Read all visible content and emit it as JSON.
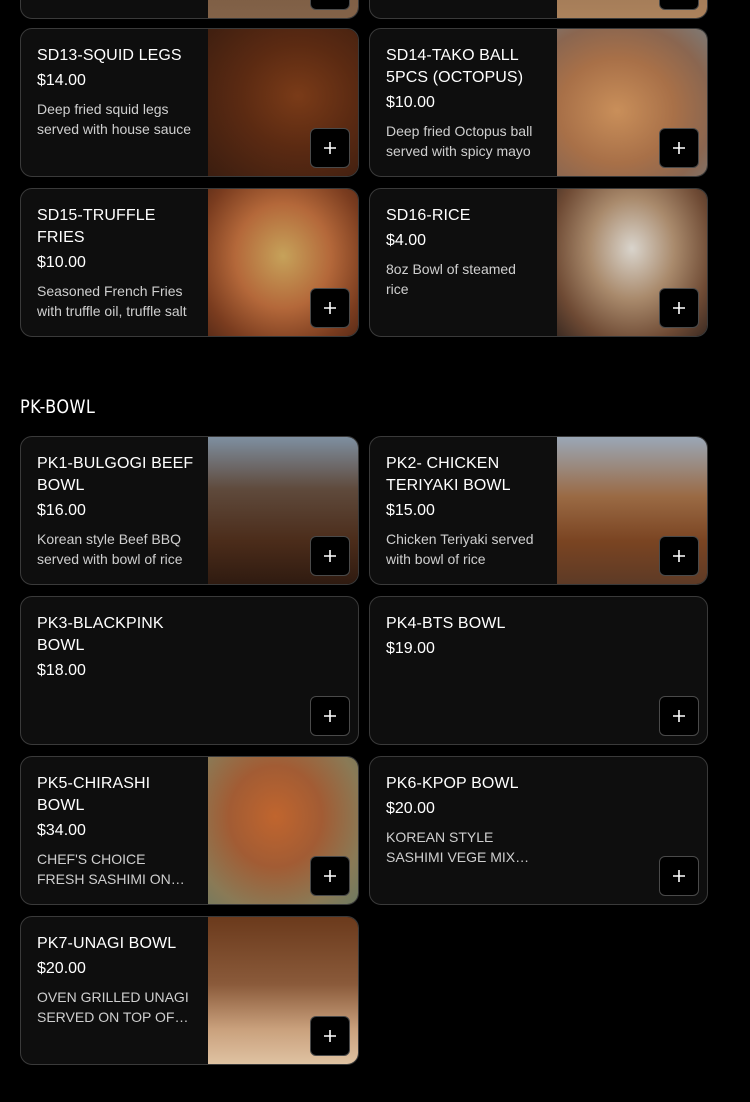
{
  "section": {
    "title": "PK-BOWL"
  },
  "icons": {
    "add": "plus-icon"
  },
  "items": [
    {
      "id": "sd13",
      "name": "SD13-SQUID LEGS",
      "price": "$14.00",
      "description": "Deep fried squid legs served with house sauce"
    },
    {
      "id": "sd14",
      "name": "SD14-TAKO BALL 5PCS (OCTOPUS)",
      "price": "$10.00",
      "description": "Deep fried Octopus ball served with spicy mayo"
    },
    {
      "id": "sd15",
      "name": "SD15-TRUFFLE FRIES",
      "price": "$10.00",
      "description": "Seasoned French Fries with truffle oil, truffle salt"
    },
    {
      "id": "sd16",
      "name": "SD16-RICE",
      "price": "$4.00",
      "description": "8oz Bowl of steamed rice"
    },
    {
      "id": "pk1",
      "name": "PK1-BULGOGI BEEF BOWL",
      "price": "$16.00",
      "description": "Korean style Beef BBQ served with bowl of rice"
    },
    {
      "id": "pk2",
      "name": "PK2- CHICKEN TERIYAKI BOWL",
      "price": "$15.00",
      "description": "Chicken Teriyaki served with bowl of rice"
    },
    {
      "id": "pk3",
      "name": "PK3-BLACKPINK BOWL",
      "price": "$18.00",
      "description": ""
    },
    {
      "id": "pk4",
      "name": "PK4-BTS BOWL",
      "price": "$19.00",
      "description": ""
    },
    {
      "id": "pk5",
      "name": "PK5-CHIRASHI BOWL",
      "price": "$34.00",
      "description": "CHEF'S CHOICE FRESH SASHIMI ON TOP OF RICE"
    },
    {
      "id": "pk6",
      "name": "PK6-KPOP BOWL",
      "price": "$20.00",
      "description": "KOREAN STYLE SASHIMI VEGE MIX BOWL"
    },
    {
      "id": "pk7",
      "name": "PK7-UNAGI BOWL",
      "price": "$20.00",
      "description": "OVEN GRILLED UNAGI SERVED ON TOP OF RICE"
    }
  ]
}
